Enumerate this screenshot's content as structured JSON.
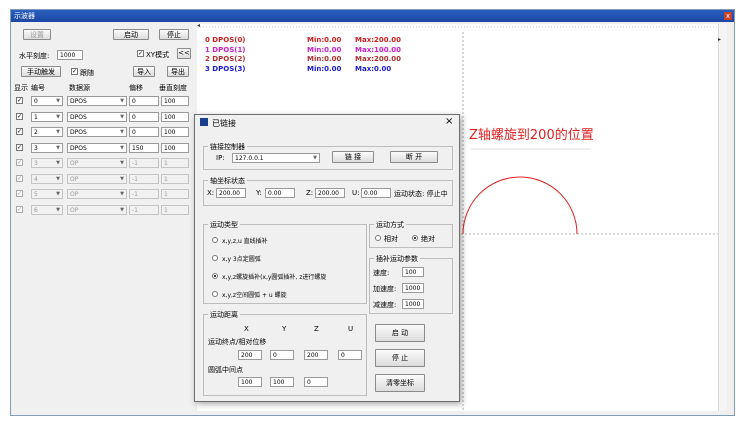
{
  "window": {
    "title": "示波器",
    "close_glyph": "x"
  },
  "left_panel": {
    "settings_btn": "设置",
    "start_btn": "启动",
    "stop_btn": "停止",
    "horiz_label": "水平刻度:",
    "horiz_value": "1000",
    "xy_label": "XY模式",
    "collapse_btn": "<<",
    "manual_trigger_btn": "手动触发",
    "follow_label": "跟随",
    "import_btn": "导入",
    "export_btn": "导出",
    "headers": {
      "show": "显示",
      "num": "编号",
      "source": "数据源",
      "offset": "偏移",
      "vscale": "垂直刻度"
    },
    "rows": [
      {
        "num": "0",
        "source": "DPOS",
        "offset": "0",
        "vscale": "100",
        "enabled": true
      },
      {
        "num": "1",
        "source": "DPOS",
        "offset": "0",
        "vscale": "100",
        "enabled": true
      },
      {
        "num": "2",
        "source": "DPOS",
        "offset": "0",
        "vscale": "100",
        "enabled": true
      },
      {
        "num": "3",
        "source": "DPOS",
        "offset": "150",
        "vscale": "100",
        "enabled": true
      },
      {
        "num": "3",
        "source": "OP",
        "offset": "-1",
        "vscale": "1",
        "enabled": false
      },
      {
        "num": "4",
        "source": "OP",
        "offset": "-1",
        "vscale": "1",
        "enabled": false
      },
      {
        "num": "5",
        "source": "OP",
        "offset": "-1",
        "vscale": "1",
        "enabled": false
      },
      {
        "num": "6",
        "source": "OP",
        "offset": "-1",
        "vscale": "1",
        "enabled": false
      }
    ]
  },
  "plot": {
    "traces": [
      {
        "label": "0 DPOS(0)",
        "min": "Min:0.00",
        "max": "Max:200.00",
        "color": "#cc2020"
      },
      {
        "label": "1 DPOS(1)",
        "min": "Min:0.00",
        "max": "Max:100.00",
        "color": "#cc20cc"
      },
      {
        "label": "2 DPOS(2)",
        "min": "Min:0.00",
        "max": "Max:200.00",
        "color": "#b03030"
      },
      {
        "label": "3 DPOS(3)",
        "min": "Min:0.00",
        "max": "Max:0.00",
        "color": "#1a1ad0"
      }
    ],
    "annotation": "Z轴螺旋到200的位置",
    "annotation_color": "#e02020",
    "curve_color": "#e02020"
  },
  "dialog": {
    "title": "已链接",
    "close_glyph": "×",
    "link_group": "链接控制器",
    "ip_label": "IP:",
    "ip_value": "127.0.0.1",
    "link_btn": "链 接",
    "disconnect_btn": "断 开",
    "axis_group": "轴坐标状态",
    "axis_x_label": "X:",
    "axis_x_value": "200.00",
    "axis_y_label": "Y:",
    "axis_y_value": "0.00",
    "axis_z_label": "Z:",
    "axis_z_value": "200.00",
    "axis_u_label": "U:",
    "axis_u_value": "0.00",
    "run_status": "运动状态: 停止中",
    "motion_type_group": "运动类型",
    "motion_options": [
      "x,y,z,u 直线插补",
      "x,y 3点定圆弧",
      "x,y,z螺旋插补(x,y圆弧插补, z进行螺旋",
      "x,y,z空间圆弧 + u 螺旋"
    ],
    "motion_selected": 2,
    "mode_group": "运动方式",
    "mode_relative": "相对",
    "mode_absolute": "绝对",
    "mode_selected": "absolute",
    "interp_group": "插补运动参数",
    "speed_label": "速度:",
    "speed_value": "100",
    "accel_label": "加速度:",
    "accel_value": "1000",
    "decel_label": "减速度:",
    "decel_value": "1000",
    "distance_group": "运动距离",
    "col_x": "X",
    "col_y": "Y",
    "col_z": "Z",
    "col_u": "U",
    "end_label": "运动终点/相对位移",
    "end_values": [
      "200",
      "0",
      "200",
      "0"
    ],
    "mid_label": "圆弧中间点",
    "mid_values": [
      "100",
      "100",
      "0"
    ],
    "start_btn": "启 动",
    "stop_btn": "停 止",
    "zero_btn": "清零坐标"
  }
}
